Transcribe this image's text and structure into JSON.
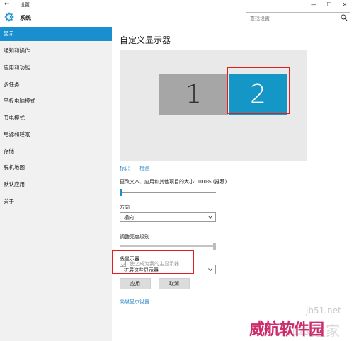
{
  "titlebar": {
    "back_icon": "←",
    "title": "设置",
    "minimize": "—",
    "maximize": "☐",
    "close": "✕"
  },
  "header": {
    "section": "系统",
    "search_placeholder": "查找设置"
  },
  "sidebar": {
    "items": [
      {
        "label": "显示",
        "active": true
      },
      {
        "label": "通知和操作"
      },
      {
        "label": "应用和功能"
      },
      {
        "label": "多任务"
      },
      {
        "label": "平板电脑模式"
      },
      {
        "label": "节电模式"
      },
      {
        "label": "电源和睡眠"
      },
      {
        "label": "存储"
      },
      {
        "label": "脱机地图"
      },
      {
        "label": "默认应用"
      },
      {
        "label": "关于"
      }
    ]
  },
  "main": {
    "title": "自定义显示器",
    "monitors": [
      {
        "label": "1"
      },
      {
        "label": "2",
        "selected": true
      }
    ],
    "identify_link": "标识",
    "detect_link": "检测",
    "scale_label": "更改文本、应用和其他项目的大小: 100% (推荐)",
    "scale_fraction": 0.0,
    "orientation_label": "方向",
    "orientation_value": "横向",
    "brightness_label": "调整亮度级别",
    "brightness_fraction": 1.0,
    "multi_display_label": "多显示器",
    "multi_display_value": "扩展这些显示器",
    "make_main_label": "使之成为我的主显示器",
    "apply_button": "应用",
    "cancel_button": "取消",
    "advanced_link": "高级显示设置"
  },
  "watermark": {
    "top": "jb51.net",
    "main": "威航软件园",
    "sub": "脚本之家"
  },
  "colors": {
    "accent": "#1a8fd0",
    "highlight": "#e02020",
    "monitor_selected": "#1497c7",
    "monitor_other": "#a6a6a6"
  }
}
